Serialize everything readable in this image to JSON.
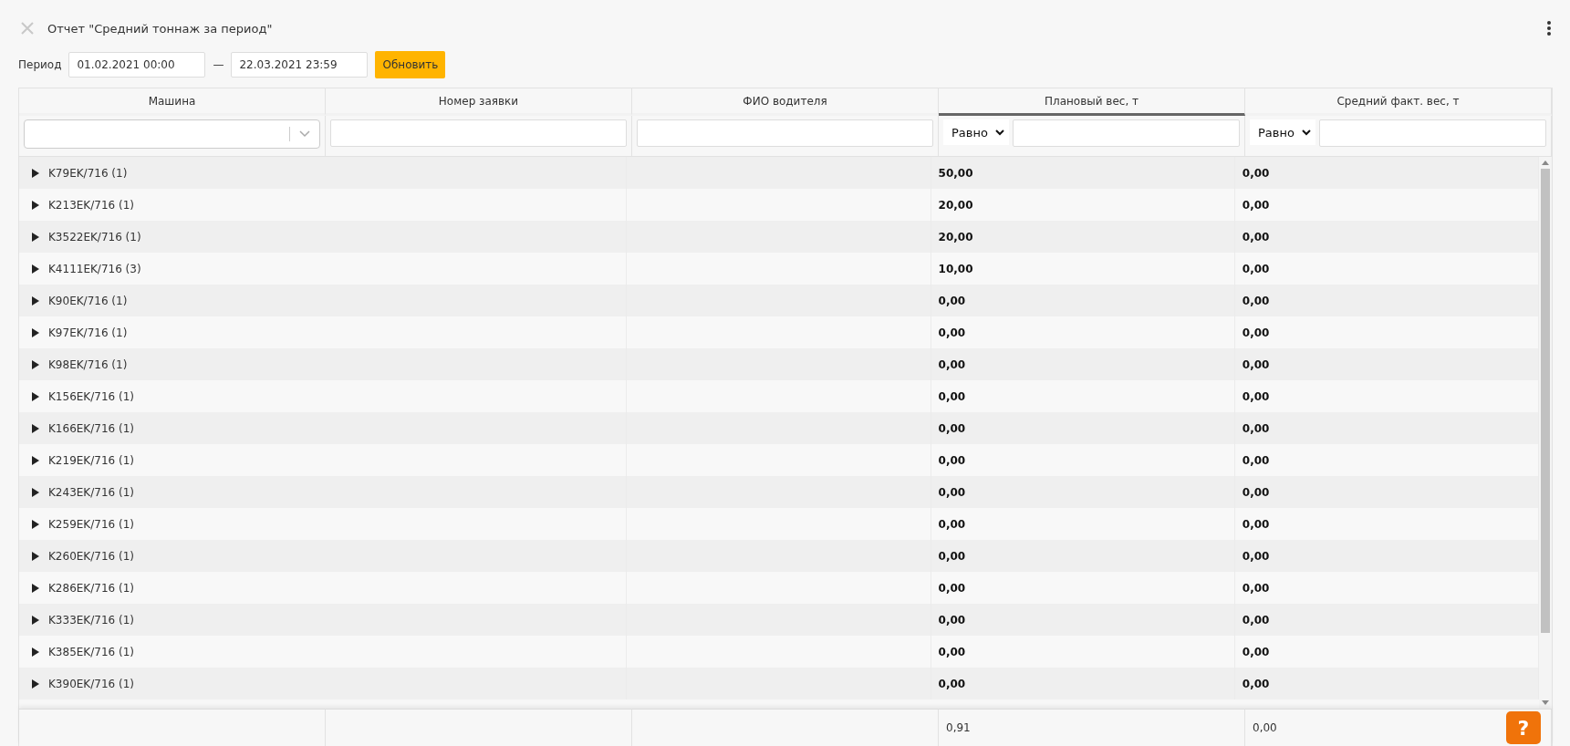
{
  "window": {
    "title": "Отчет \"Средний тоннаж за период\""
  },
  "period": {
    "label": "Период",
    "from": "01.02.2021 00:00",
    "separator": "—",
    "to": "22.03.2021 23:59",
    "button": "Обновить"
  },
  "table": {
    "columns": [
      {
        "label": "Машина",
        "sorted": false,
        "kind": "combo"
      },
      {
        "label": "Номер заявки",
        "sorted": false,
        "kind": "text"
      },
      {
        "label": "ФИО водителя",
        "sorted": false,
        "kind": "text"
      },
      {
        "label": "Плановый вес, т",
        "sorted": true,
        "kind": "compare",
        "operator": "Равно"
      },
      {
        "label": "Средний факт. вес, т",
        "sorted": false,
        "kind": "compare",
        "operator": "Равно"
      }
    ],
    "rows": [
      {
        "vehicle": "K79EK/716 (1)",
        "expanded": false,
        "plan": "50,00",
        "actual": "0,00"
      },
      {
        "vehicle": "K213EK/716 (1)",
        "expanded": false,
        "plan": "20,00",
        "actual": "0,00"
      },
      {
        "vehicle": "K3522EK/716 (1)",
        "expanded": false,
        "plan": "20,00",
        "actual": "0,00"
      },
      {
        "vehicle": "K4111EK/716 (3)",
        "expanded": false,
        "plan": "10,00",
        "actual": "0,00"
      },
      {
        "vehicle": "K90EK/716 (1)",
        "expanded": false,
        "plan": "0,00",
        "actual": "0,00"
      },
      {
        "vehicle": "K97EK/716 (1)",
        "expanded": false,
        "plan": "0,00",
        "actual": "0,00"
      },
      {
        "vehicle": "K98EK/716 (1)",
        "expanded": false,
        "plan": "0,00",
        "actual": "0,00"
      },
      {
        "vehicle": "K156EK/716 (1)",
        "expanded": false,
        "plan": "0,00",
        "actual": "0,00"
      },
      {
        "vehicle": "K166EK/716 (1)",
        "expanded": false,
        "plan": "0,00",
        "actual": "0,00"
      },
      {
        "vehicle": "K219EK/716 (1)",
        "expanded": false,
        "plan": "0,00",
        "actual": "0,00"
      },
      {
        "vehicle": "K243EK/716 (1)",
        "expanded": false,
        "plan": "0,00",
        "actual": "0,00"
      },
      {
        "vehicle": "K259EK/716 (1)",
        "expanded": false,
        "plan": "0,00",
        "actual": "0,00"
      },
      {
        "vehicle": "K260EK/716 (1)",
        "expanded": false,
        "plan": "0,00",
        "actual": "0,00"
      },
      {
        "vehicle": "K286EK/716 (1)",
        "expanded": false,
        "plan": "0,00",
        "actual": "0,00"
      },
      {
        "vehicle": "K333EK/716 (1)",
        "expanded": false,
        "plan": "0,00",
        "actual": "0,00"
      },
      {
        "vehicle": "K385EK/716 (1)",
        "expanded": false,
        "plan": "0,00",
        "actual": "0,00"
      },
      {
        "vehicle": "K390EK/716 (1)",
        "expanded": false,
        "plan": "0,00",
        "actual": "0,00"
      }
    ],
    "totals": {
      "plan": "0,91",
      "actual": "0,00"
    }
  },
  "help_button": "?"
}
